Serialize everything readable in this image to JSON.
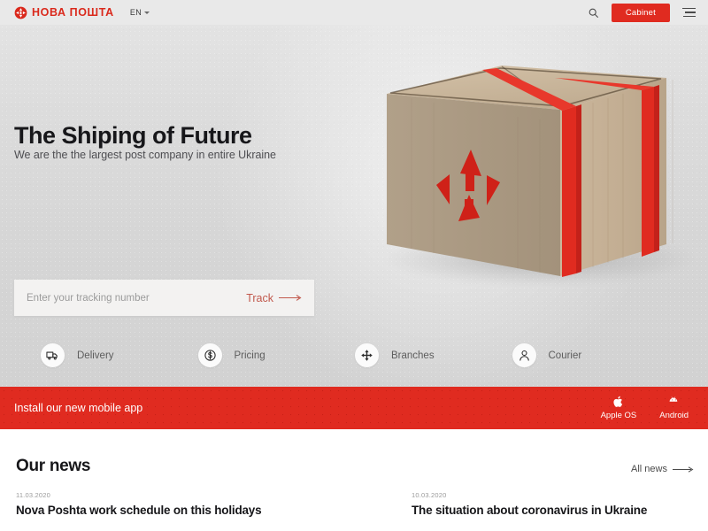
{
  "header": {
    "logo_icon": "nova-poshta-arrows-icon",
    "logo_text": "НОВА ПОШТА",
    "language": "EN",
    "language_caret_icon": "chevron-down-icon",
    "search_icon": "search-icon",
    "cabinet_label": "Cabinet",
    "menu_icon": "hamburger-menu-icon",
    "accent_color": "#e02b20"
  },
  "hero": {
    "title": "The Shiping of Future",
    "subtitle": "We are the the largest post company in entire Ukraine",
    "illustration": "cardboard-parcel-box-with-red-tape",
    "tracking": {
      "placeholder": "Enter your tracking number",
      "value": "",
      "button_label": "Track",
      "button_icon": "long-arrow-right-icon",
      "button_color": "#c1584c"
    },
    "services": [
      {
        "label": "Delivery",
        "icon": "delivery-truck-icon"
      },
      {
        "label": "Pricing",
        "icon": "dollar-coin-icon"
      },
      {
        "label": "Branches",
        "icon": "move-arrows-icon"
      },
      {
        "label": "Courier",
        "icon": "person-icon"
      }
    ]
  },
  "banner": {
    "text": "Install our new mobile app",
    "background_color": "#e02b20",
    "apps": [
      {
        "label": "Apple OS",
        "icon": "apple-icon"
      },
      {
        "label": "Android",
        "icon": "android-icon"
      }
    ]
  },
  "news": {
    "heading": "Our news",
    "all_news_label": "All news",
    "all_news_icon": "long-arrow-right-icon",
    "items": [
      {
        "date": "11.03.2020",
        "title": "Nova Poshta work schedule on this holidays"
      },
      {
        "date": "10.03.2020",
        "title": "The situation about coronavirus in Ukraine"
      }
    ]
  }
}
